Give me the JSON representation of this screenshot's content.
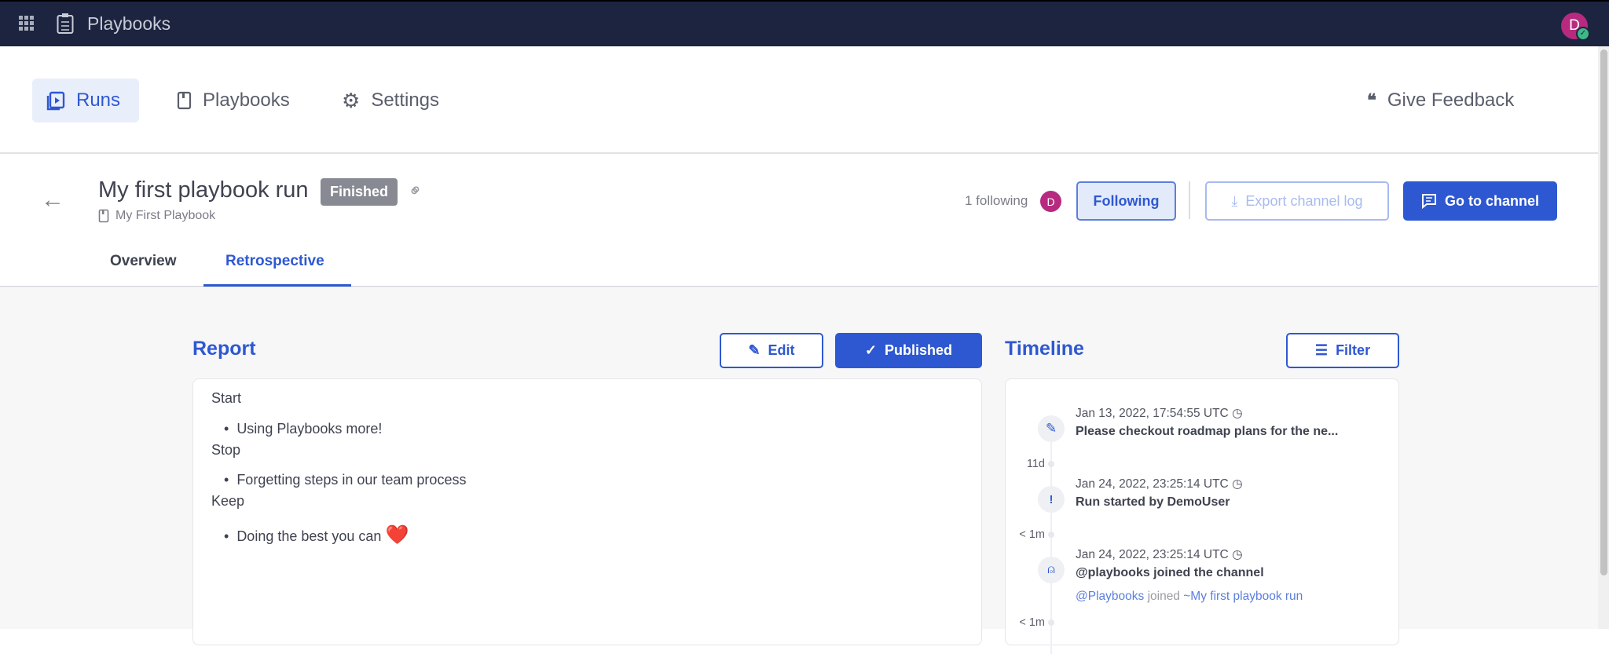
{
  "app": {
    "title": "Playbooks",
    "avatar_initial": "D"
  },
  "nav": {
    "items": [
      {
        "label": "Runs",
        "icon": "runs-icon",
        "active": true
      },
      {
        "label": "Playbooks",
        "icon": "playbook-icon"
      },
      {
        "label": "Settings",
        "icon": "gear-icon"
      }
    ],
    "feedback": "Give Feedback"
  },
  "run": {
    "title": "My first playbook run",
    "status": "Finished",
    "playbook": "My First Playbook",
    "followers": "1 following",
    "follower_initial": "D",
    "following_btn": "Following",
    "export_btn": "Export channel log",
    "goto_btn": "Go to channel"
  },
  "tabs": [
    {
      "label": "Overview"
    },
    {
      "label": "Retrospective",
      "active": true
    }
  ],
  "report": {
    "title": "Report",
    "edit": "Edit",
    "published": "Published",
    "sections": [
      {
        "heading": "Start",
        "item": "Using Playbooks more!"
      },
      {
        "heading": "Stop",
        "item": "Forgetting steps in our team process"
      },
      {
        "heading": "Keep",
        "item": "Doing the best you can",
        "emoji": "❤️"
      }
    ]
  },
  "timeline": {
    "title": "Timeline",
    "filter": "Filter",
    "events": [
      {
        "time": "Jan 13, 2022, 17:54:55 UTC",
        "text": "Please checkout roadmap plans for the ne...",
        "icon": "pencil-icon"
      },
      {
        "time": "Jan 24, 2022, 23:25:14 UTC",
        "text": "Run started by DemoUser",
        "icon": "shield-alert-icon"
      },
      {
        "time": "Jan 24, 2022, 23:25:14 UTC",
        "text": "@playbooks joined the channel",
        "icon": "user-icon",
        "detail_user": "@Playbooks",
        "detail_verb": "joined",
        "detail_channel": "~My first playbook run"
      }
    ],
    "deltas": [
      "11d",
      "< 1m",
      "< 1m"
    ]
  },
  "colors": {
    "accent": "#2e58d1",
    "topbar": "#1c2440",
    "avatar": "#b72a7f",
    "badge": "#878a93"
  }
}
